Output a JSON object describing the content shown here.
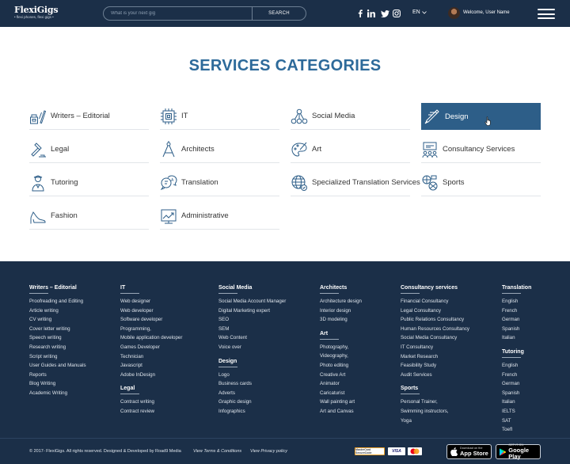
{
  "header": {
    "logo_text": "FlexiGigs",
    "logo_tagline": "• flexi phones, flexi gigs •",
    "search_placeholder": "What is your next gig",
    "search_button": "SEARCH",
    "language": "EN",
    "welcome": "Welcome, User Name",
    "social_icons": [
      "facebook-icon",
      "linkedin-icon",
      "twitter-icon",
      "instagram-icon"
    ]
  },
  "page_title": "SERVICES CATEGORIES",
  "categories": [
    {
      "label": "Writers – Editorial",
      "icon": "writing-tools-icon"
    },
    {
      "label": "IT",
      "icon": "chip-icon"
    },
    {
      "label": "Social Media",
      "icon": "social-network-icon"
    },
    {
      "label": "Design",
      "icon": "pen-tool-icon",
      "selected": true
    },
    {
      "label": "Legal",
      "icon": "gavel-icon"
    },
    {
      "label": "Architects",
      "icon": "compass-icon"
    },
    {
      "label": "Art",
      "icon": "palette-icon"
    },
    {
      "label": "Consultancy Services",
      "icon": "meeting-icon"
    },
    {
      "label": "Tutoring",
      "icon": "teacher-icon"
    },
    {
      "label": "Translation",
      "icon": "speech-bubbles-icon"
    },
    {
      "label": "Specialized Translation Services",
      "icon": "globe-icon"
    },
    {
      "label": "Sports",
      "icon": "sports-balls-icon"
    },
    {
      "label": "Fashion",
      "icon": "high-heel-icon"
    },
    {
      "label": "Administrative",
      "icon": "chart-icon"
    }
  ],
  "footer": {
    "writers": {
      "title": "Writers – Editorial",
      "items": [
        "Proofreading and Editing",
        "Article writing",
        "CV writing",
        "Cover letter writing",
        "Speech writing",
        "Research writing",
        "Script writing",
        "User Guides and Manuals",
        "Reports",
        "Blog Writing",
        "Academic Writing"
      ]
    },
    "it": {
      "title": "IT",
      "items": [
        "Web designer",
        "Web developer",
        "Software developer",
        "Programming,",
        "Mobile application developer",
        "Games Developer",
        "Technician",
        "Javascript",
        "Adobe InDesign"
      ]
    },
    "legal": {
      "title": "Legal",
      "items": [
        "Contract writing",
        "Contract review"
      ]
    },
    "social": {
      "title": "Social Media",
      "items": [
        "Social Media Account Manager",
        "Digital Marketing expert",
        "SEO",
        "SEM",
        "Web Content",
        "Voice over"
      ]
    },
    "design": {
      "title": "Design",
      "items": [
        "Logo",
        "Business cards",
        "Adverts",
        "Graphic design",
        "Infographics"
      ]
    },
    "architects": {
      "title": "Architects",
      "items": [
        "Architecture design",
        "Interior design",
        "3D modeling"
      ]
    },
    "art": {
      "title": "Art",
      "items": [
        "Photography,",
        "Videography,",
        "Photo editing",
        "Creative Art",
        "Animator",
        "Caricaturist",
        "Wall painting art",
        "Art and Canvas"
      ]
    },
    "consultancy": {
      "title": "Consultancy services",
      "items": [
        "Financial Consultancy",
        "Legal Consultancy",
        "Public Relations Consultancy",
        "Human Resources Consultancy",
        "Social Media Consultancy",
        "IT Consultancy",
        "Market Research",
        "Feasibility Study",
        "Audit Services"
      ]
    },
    "sports": {
      "title": "Sports",
      "items": [
        "Personal Trainer,",
        "Swimming instructors,",
        "Yoga"
      ]
    },
    "translation": {
      "title": "Translation",
      "items": [
        "English",
        "French",
        "German",
        "Spanish",
        "Italian"
      ]
    },
    "tutoring": {
      "title": "Tutoring",
      "items": [
        "English",
        "French",
        "German",
        "Spanish",
        "Italian",
        "IELTS",
        "SAT",
        "Toefl"
      ]
    }
  },
  "bottom": {
    "copyright": "© 2017- FlexiGigs. All rights reserved. Designed & Developed by Road9 Media",
    "terms": "View Terms & Conditions",
    "privacy": "View Privacy policy",
    "payments": [
      "MasterCard SecureCode",
      "VISA",
      "mastercard"
    ],
    "app_store_small": "Download on the",
    "app_store_big": "App Store",
    "google_play_small": "GET IT ON",
    "google_play_big": "Google Play"
  },
  "colors": {
    "navy": "#1b2f48",
    "accent_blue": "#2d6a9a",
    "selected_bg": "#2d5e88"
  }
}
